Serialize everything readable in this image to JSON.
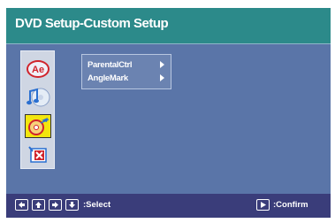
{
  "window": {
    "title": "DVD Setup-Custom Setup"
  },
  "side_icons": [
    {
      "icon": "language-ae-icon",
      "active": false
    },
    {
      "icon": "audio-music-icon",
      "active": false
    },
    {
      "icon": "disc-tools-icon",
      "active": true
    },
    {
      "icon": "exit-icon",
      "active": false
    }
  ],
  "submenu": {
    "items": [
      {
        "label": "ParentalCtrl"
      },
      {
        "label": "AngleMark"
      }
    ]
  },
  "footer": {
    "select_label": ":Select",
    "confirm_label": ":Confirm"
  },
  "colors": {
    "title_bar": "#2c8a8a",
    "screen_bg": "#5a75a8",
    "footer_bg": "#3a3d7a",
    "highlight": "#f2e60e"
  }
}
